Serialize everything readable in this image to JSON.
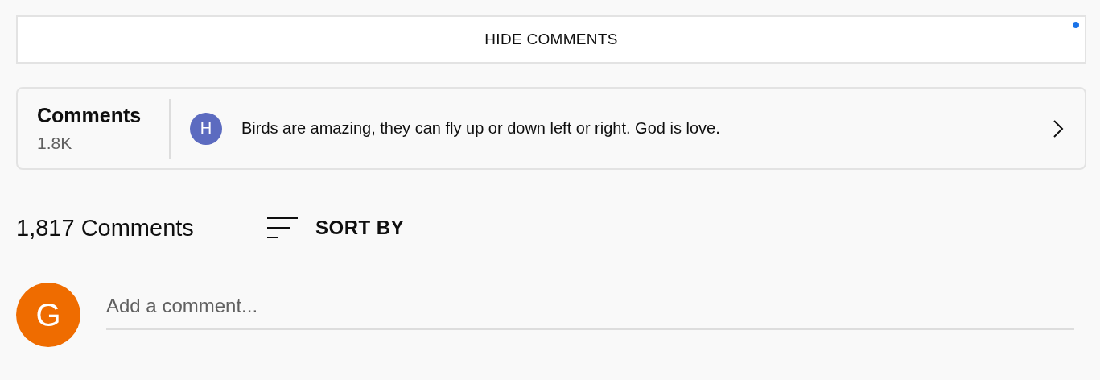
{
  "hide_button": {
    "label": "HIDE COMMENTS",
    "notification": true
  },
  "teaser": {
    "title": "Comments",
    "count": "1.8K",
    "avatar_letter": "H",
    "comment": "Birds are amazing, they can fly up or down left or right. God is love."
  },
  "header": {
    "count": "1,817 Comments",
    "sort_label": "SORT BY"
  },
  "composer": {
    "avatar_letter": "G",
    "placeholder": "Add a comment..."
  }
}
